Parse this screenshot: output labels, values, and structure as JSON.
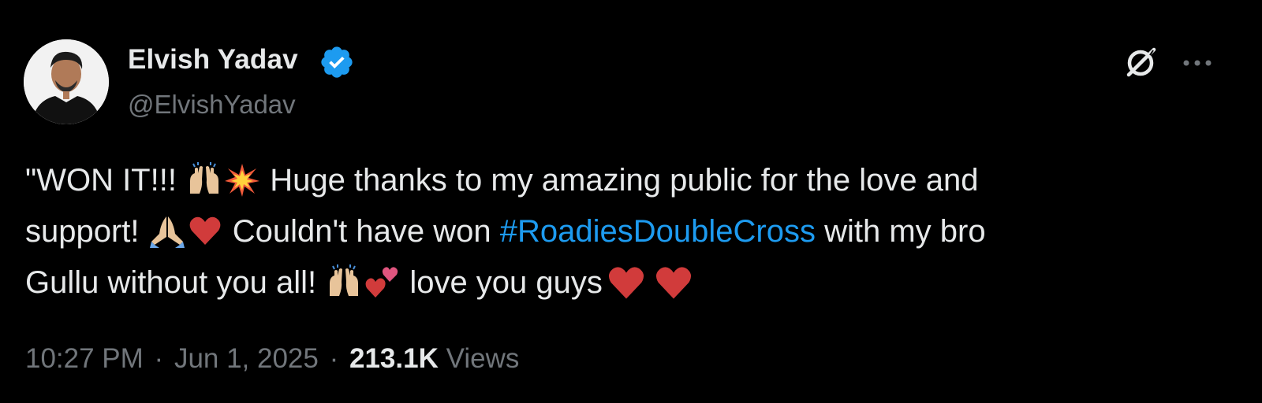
{
  "author": {
    "name": "Elvish Yadav",
    "handle": "@ElvishYadav",
    "verified": true
  },
  "header_actions": {
    "grok_icon": "grok-icon",
    "more_icon": "more-dots-icon"
  },
  "tweet": {
    "line1_a": "\"WON IT!!! ",
    "line1_b": " Huge thanks to my amazing public for the love and",
    "line2_a": "support! ",
    "line2_b": " Couldn't have won ",
    "hashtag": "#RoadiesDoubleCross",
    "line2_c": " with my bro",
    "line3_a": "Gullu  without you all! ",
    "line3_b": " love you guys",
    "emojis": [
      "raising-hands-emoji",
      "collision-emoji",
      "folded-hands-emoji",
      "red-heart-emoji",
      "two-hearts-emoji"
    ]
  },
  "meta": {
    "time": "10:27 PM",
    "date": "Jun 1, 2025",
    "separator": "·",
    "views_count": "213.1K",
    "views_label": "Views"
  },
  "colors": {
    "background": "#000000",
    "text": "#e7e9ea",
    "muted": "#71767b",
    "link": "#1d9bf0",
    "verified": "#1d9bf0",
    "heart": "#d13b3b"
  }
}
